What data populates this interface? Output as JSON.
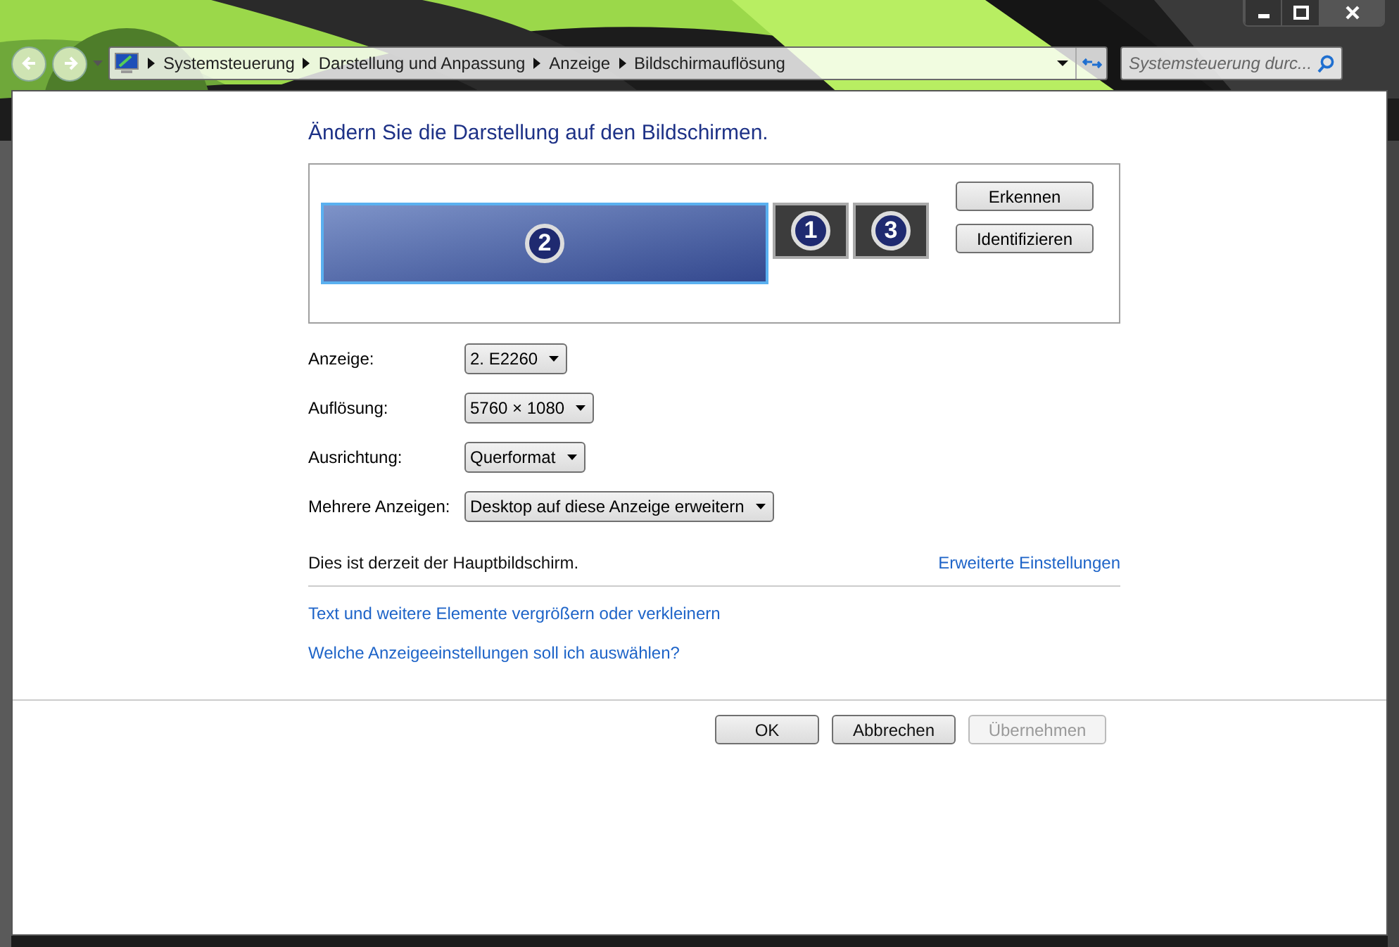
{
  "window": {
    "controls": [
      {
        "kind": "minimize"
      },
      {
        "kind": "maximize"
      },
      {
        "kind": "close"
      }
    ]
  },
  "breadcrumb": [
    "Systemsteuerung",
    "Darstellung und Anpassung",
    "Anzeige",
    "Bildschirmauflösung"
  ],
  "search": {
    "placeholder": "Systemsteuerung durc..."
  },
  "heading": "Ändern Sie die Darstellung auf den Bildschirmen.",
  "monitors": [
    {
      "label": "2",
      "selected": true
    },
    {
      "label": "1",
      "selected": false
    },
    {
      "label": "3",
      "selected": false
    }
  ],
  "monitor_buttons": [
    "Erkennen",
    "Identifizieren"
  ],
  "settings": [
    {
      "label": "Anzeige:",
      "value": "2. E2260"
    },
    {
      "label": "Auflösung:",
      "value": "5760 × 1080"
    },
    {
      "label": "Ausrichtung:",
      "value": "Querformat"
    },
    {
      "label": "Mehrere Anzeigen:",
      "value": "Desktop auf diese Anzeige erweitern"
    }
  ],
  "status_text": "Dies ist derzeit der Hauptbildschirm.",
  "advanced_link": "Erweiterte Einstellungen",
  "links": [
    "Text und weitere Elemente vergrößern oder verkleinern",
    "Welche Anzeigeeinstellungen soll ich auswählen?"
  ],
  "buttons": [
    {
      "label": "OK",
      "disabled": false
    },
    {
      "label": "Abbrechen",
      "disabled": false
    },
    {
      "label": "Übernehmen",
      "disabled": true
    }
  ]
}
